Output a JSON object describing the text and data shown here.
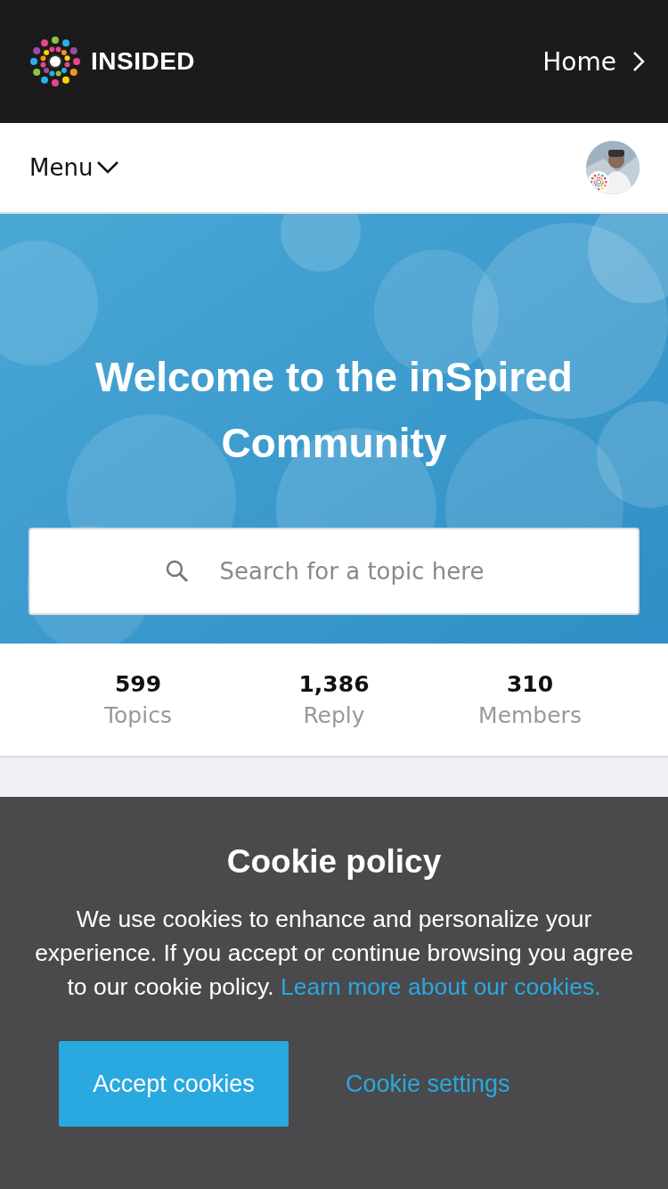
{
  "header": {
    "brand": "INSIDED",
    "nav_link": "Home"
  },
  "menubar": {
    "menu_label": "Menu"
  },
  "hero": {
    "title": "Welcome to the inSpired Community",
    "search": {
      "placeholder": "Search for a topic here"
    }
  },
  "stats": [
    {
      "value": "599",
      "label": "Topics"
    },
    {
      "value": "1,386",
      "label": "Reply"
    },
    {
      "value": "310",
      "label": "Members"
    }
  ],
  "cookie_banner": {
    "title": "Cookie policy",
    "text": "We use cookies to enhance and personalize your experience. If you accept or continue browsing you agree to our cookie policy.",
    "link": "Learn more about our cookies.",
    "accept_button": "Accept cookies",
    "settings_button": "Cookie settings"
  }
}
